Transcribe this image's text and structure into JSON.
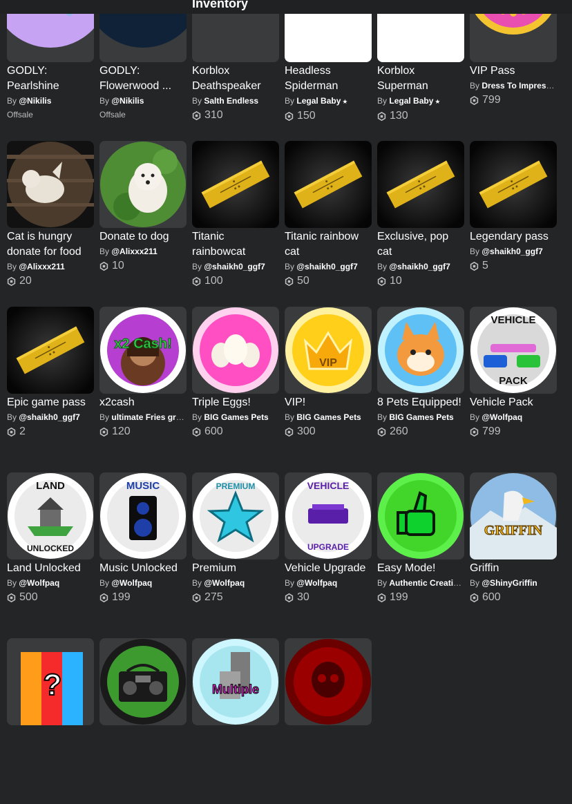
{
  "header": {
    "title": "Inventory"
  },
  "items": [
    {
      "name": "GODLY: Pearlshine",
      "by": "By",
      "creator": "@Nikilis",
      "offsale": "Offsale",
      "icon": "pearlshine-icon"
    },
    {
      "name": "GODLY: Flowerwood ...",
      "by": "By",
      "creator": "@Nikilis",
      "offsale": "Offsale",
      "icon": "flowerwood-icon"
    },
    {
      "name": "Korblox Deathspeaker",
      "by": "By",
      "creator": "Salth Endless",
      "price": "310",
      "icon": "korblox-deathspeaker-icon"
    },
    {
      "name": "Headless Spiderman",
      "by": "By",
      "creator": "Legal Baby",
      "verified": "★",
      "price": "150",
      "icon": "no-image-icon"
    },
    {
      "name": "Korblox Superman",
      "by": "By",
      "creator": "Legal Baby",
      "verified": "★",
      "price": "130",
      "icon": "no-image-icon"
    },
    {
      "name": "VIP Pass",
      "by": "By",
      "creator": "Dress To Impress ...",
      "price": "799",
      "icon": "vip-pass-icon"
    },
    {
      "name": "Cat is hungry donate for food",
      "by": "By",
      "creator": "@Alixxx211",
      "price": "20",
      "icon": "cat-photo-icon"
    },
    {
      "name": "Donate to dog",
      "by": "By",
      "creator": "@Alixxx211",
      "price": "10",
      "icon": "dog-photo-icon"
    },
    {
      "name": "Titanic rainbowcat",
      "by": "By",
      "creator": "@shaikh0_ggf7",
      "price": "100",
      "icon": "gamepass-ticket-icon"
    },
    {
      "name": "Titanic rainbow cat",
      "by": "By",
      "creator": "@shaikh0_ggf7",
      "price": "50",
      "icon": "gamepass-ticket-icon"
    },
    {
      "name": "Exclusive, pop cat",
      "by": "By",
      "creator": "@shaikh0_ggf7",
      "price": "10",
      "icon": "gamepass-ticket-icon"
    },
    {
      "name": "Legendary pass",
      "by": "By",
      "creator": "@shaikh0_ggf7",
      "price": "5",
      "icon": "gamepass-ticket-icon"
    },
    {
      "name": "Epic game pass",
      "by": "By",
      "creator": "@shaikh0_ggf7",
      "price": "2",
      "icon": "gamepass-ticket-icon"
    },
    {
      "name": "x2cash",
      "by": "By",
      "creator": "ultimate Fries gro...",
      "price": "120",
      "icon": "x2-cash-icon"
    },
    {
      "name": "Triple Eggs!",
      "by": "By",
      "creator": "BIG Games Pets",
      "price": "600",
      "icon": "triple-eggs-icon"
    },
    {
      "name": "VIP!",
      "by": "By",
      "creator": "BIG Games Pets",
      "price": "300",
      "icon": "vip-crown-icon"
    },
    {
      "name": "8 Pets Equipped!",
      "by": "By",
      "creator": "BIG Games Pets",
      "price": "260",
      "icon": "pet-corgi-icon"
    },
    {
      "name": "Vehicle Pack",
      "by": "By",
      "creator": "@Wolfpaq",
      "price": "799",
      "icon": "vehicle-pack-icon",
      "badge_top": "VEHICLE",
      "badge_bottom": "PACK"
    },
    {
      "name": "Land Unlocked",
      "by": "By",
      "creator": "@Wolfpaq",
      "price": "500",
      "icon": "land-unlocked-icon",
      "badge_top": "LAND",
      "badge_bottom": "UNLOCKED"
    },
    {
      "name": "Music Unlocked",
      "by": "By",
      "creator": "@Wolfpaq",
      "price": "199",
      "icon": "music-speaker-icon",
      "badge_top": "MUSIC"
    },
    {
      "name": "Premium",
      "by": "By",
      "creator": "@Wolfpaq",
      "price": "275",
      "icon": "premium-star-icon",
      "badge_top": "PREMIUM"
    },
    {
      "name": "Vehicle Upgrade",
      "by": "By",
      "creator": "@Wolfpaq",
      "price": "30",
      "icon": "vehicle-upgrade-icon",
      "badge_top": "VEHICLE",
      "badge_bottom": "UPGRADE"
    },
    {
      "name": "Easy Mode!",
      "by": "By",
      "creator": "Authentic Creatio...",
      "price": "199",
      "icon": "thumbs-up-icon"
    },
    {
      "name": "Griffin",
      "by": "By",
      "creator": "@ShinyGriffin",
      "price": "600",
      "icon": "griffin-icon",
      "badge_top": "GRIFFIN"
    },
    {
      "icon": "lucky-block-icon"
    },
    {
      "icon": "boombox-icon"
    },
    {
      "icon": "multiple-icon",
      "badge_top": "Multiple"
    },
    {
      "icon": "red-skull-icon"
    }
  ]
}
